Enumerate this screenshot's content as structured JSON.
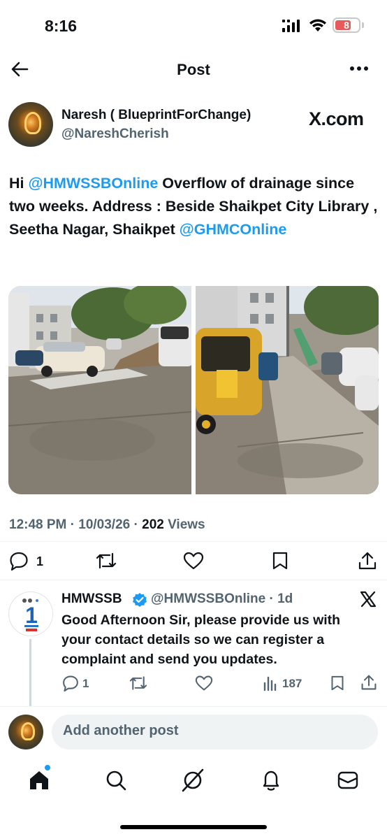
{
  "status_bar": {
    "time": "8:16",
    "battery": "8"
  },
  "nav": {
    "title": "Post",
    "back_icon": "arrow-left-icon",
    "more_icon": "more-horizontal-icon"
  },
  "post": {
    "author_name": "Naresh ( BlueprintForChange)",
    "author_handle": "@NareshCherish",
    "source_badge": "X.com",
    "text_parts": {
      "p1": "Hi ",
      "m1": "@HMWSSBOnline",
      "p2": " Overflow of drainage since two weeks. Address : Beside Shaikpet City Library , Seetha Nagar, Shaikpet ",
      "m2": "@GHMCOnline"
    },
    "meta": {
      "time": "12:48 PM",
      "sep": " · ",
      "date": "10/03/26",
      "views_count": "202",
      "views_label": " Views"
    },
    "actions": {
      "replies": "1"
    }
  },
  "reply": {
    "name": "HMWSSB",
    "handle": "@HMWSSBOnline · 1d",
    "text": "Good Afternoon Sir, please provide us with your contact details so we can register a complaint and send you updates.",
    "actions": {
      "replies": "1",
      "views": "187"
    }
  },
  "compose": {
    "placeholder": "Add another post"
  },
  "colors": {
    "accent": "#1d9bf0",
    "text": "#0f1419",
    "muted": "#536471"
  }
}
